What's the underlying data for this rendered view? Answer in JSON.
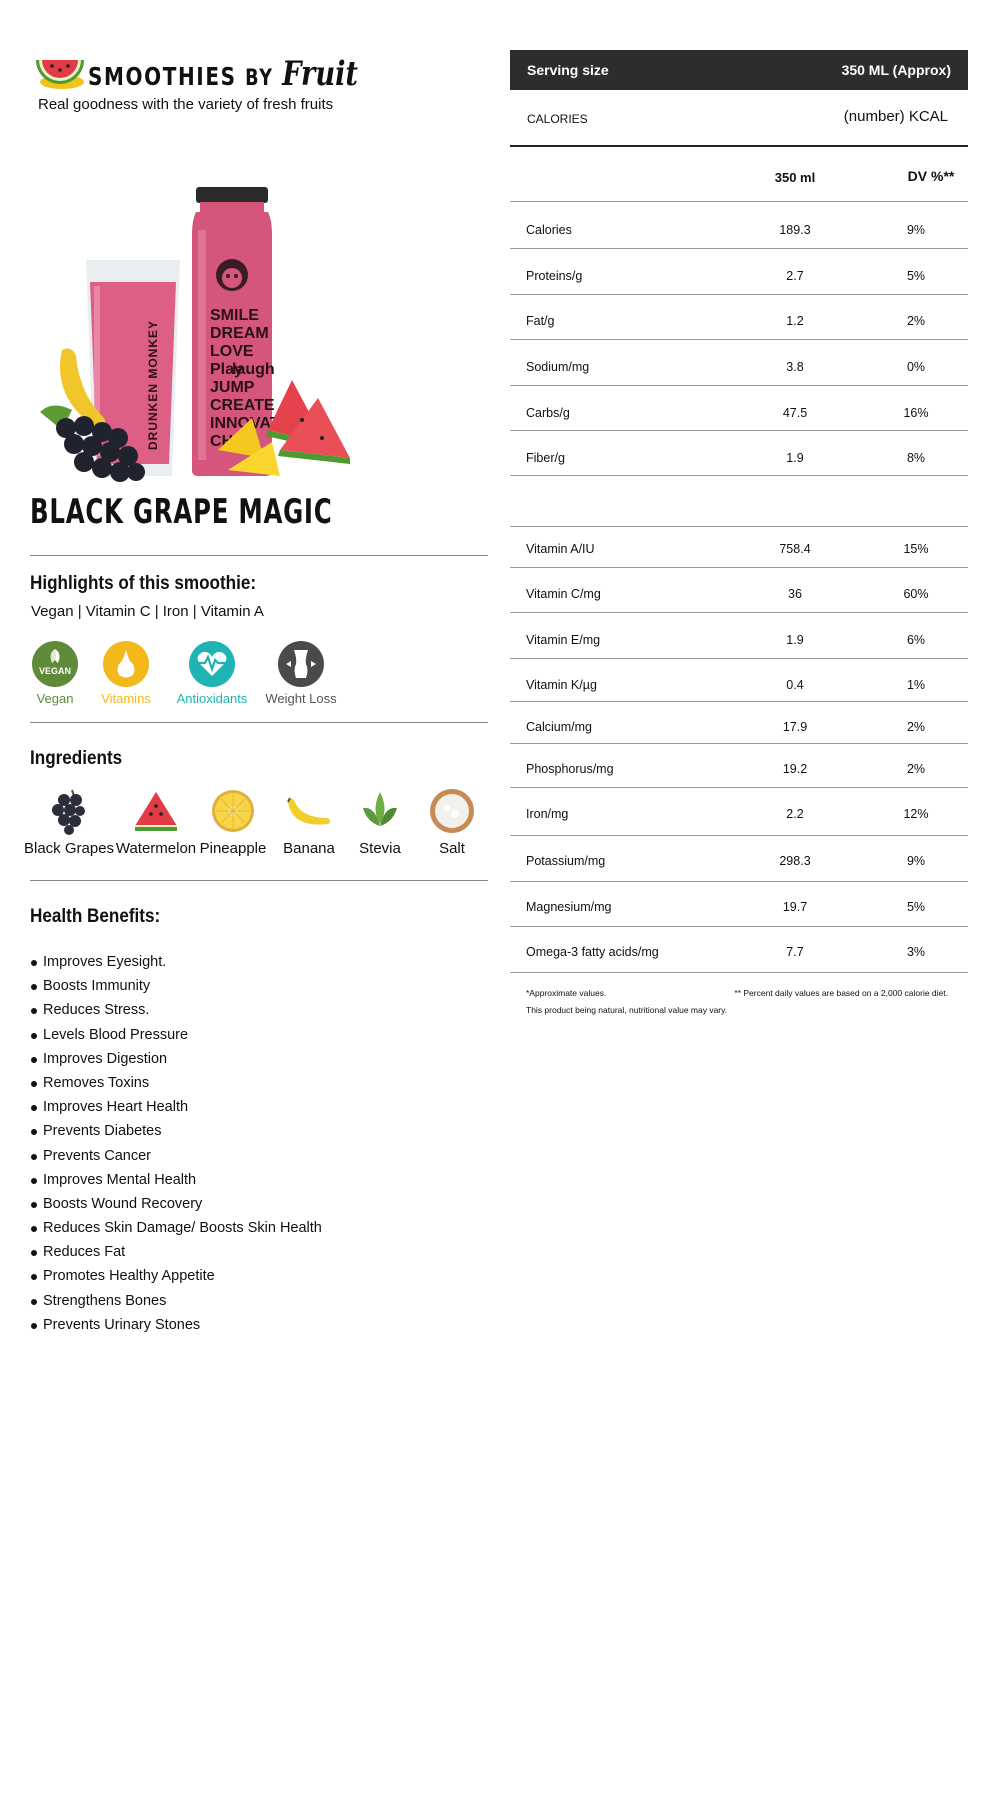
{
  "brand": {
    "name_main": "SMOOTHIES",
    "name_by": "BY",
    "name_fruit": "Fruit",
    "tagline": "Real goodness with the variety of fresh fruits"
  },
  "hero": {
    "glass_text": "DRUNKEN MONKEY",
    "bottle_text": [
      "SMILE",
      "DREAM",
      "LOVE",
      "Play",
      "laugh",
      "JUMP",
      "CREATE",
      "INNOVATE",
      "CHILL"
    ]
  },
  "product": {
    "title": "BLACK GRAPE MAGIC"
  },
  "highlights": {
    "heading": "Highlights of this smoothie:",
    "text": "Vegan | Vitamin C | Iron | Vitamin A",
    "badges": [
      {
        "label": "Vegan",
        "color": "#5f8a3a",
        "icon": "vegan-leaf-icon",
        "icon_text": "VEGAN"
      },
      {
        "label": "Vitamins",
        "color": "#f2b81c",
        "icon": "pear-icon"
      },
      {
        "label": "Antioxidants",
        "color": "#1fb3b3",
        "icon": "heartbeat-icon"
      },
      {
        "label": "Weight Loss",
        "color": "#4a4a4a",
        "icon": "body-shape-icon"
      }
    ]
  },
  "ingredients": {
    "heading": "Ingredients",
    "items": [
      {
        "label": "Black Grapes",
        "icon": "black-grapes-icon"
      },
      {
        "label": "Watermelon",
        "icon": "watermelon-icon"
      },
      {
        "label": "Pineapple",
        "icon": "pineapple-icon"
      },
      {
        "label": "Banana",
        "icon": "banana-icon"
      },
      {
        "label": "Stevia",
        "icon": "stevia-leaf-icon"
      },
      {
        "label": "Salt",
        "icon": "salt-bowl-icon"
      }
    ]
  },
  "benefits": {
    "heading": "Health Benefits:",
    "items": [
      "Improves Eyesight.",
      "Boosts Immunity",
      "Reduces Stress.",
      "Levels Blood Pressure",
      "Improves Digestion",
      "Removes Toxins",
      "Improves Heart Health",
      "Prevents Diabetes",
      "Prevents Cancer",
      "Improves Mental Health",
      "Boosts Wound Recovery",
      "Reduces Skin Damage/ Boosts Skin Health",
      "Reduces Fat",
      "Promotes Healthy Appetite",
      "Strengthens Bones",
      "Prevents Urinary Stones"
    ]
  },
  "nutrition": {
    "serving_label": "Serving size",
    "serving_value": "350 ML (Approx)",
    "calories_label": "CALORIES",
    "calories_value": "(number) KCAL",
    "col_amount": "350 ml",
    "col_dv": "DV %**",
    "macros": [
      {
        "name": "Calories",
        "value": "189.3",
        "dv": "9%"
      },
      {
        "name": "Proteins/g",
        "value": "2.7",
        "dv": "5%"
      },
      {
        "name": "Fat/g",
        "value": "1.2",
        "dv": "2%"
      },
      {
        "name": "Sodium/mg",
        "value": "3.8",
        "dv": "0%"
      },
      {
        "name": "Carbs/g",
        "value": "47.5",
        "dv": "16%"
      },
      {
        "name": "Fiber/g",
        "value": "1.9",
        "dv": "8%"
      }
    ],
    "micros": [
      {
        "name": "Vitamin A/IU",
        "value": "758.4",
        "dv": "15%"
      },
      {
        "name": "Vitamin C/mg",
        "value": "36",
        "dv": "60%"
      },
      {
        "name": "Vitamin E/mg",
        "value": "1.9",
        "dv": "6%"
      },
      {
        "name": "Vitamin K/µg",
        "value": "0.4",
        "dv": "1%"
      },
      {
        "name": "Calcium/mg",
        "value": "17.9",
        "dv": "2%"
      },
      {
        "name": "Phosphorus/mg",
        "value": "19.2",
        "dv": "2%"
      },
      {
        "name": "Iron/mg",
        "value": "2.2",
        "dv": "12%"
      },
      {
        "name": "Potassium/mg",
        "value": "298.3",
        "dv": "9%"
      },
      {
        "name": "Magnesium/mg",
        "value": "19.7",
        "dv": "5%"
      },
      {
        "name": "Omega-3 fatty acids/mg",
        "value": "7.7",
        "dv": "3%"
      }
    ],
    "footnote_1": "*Approximate values.",
    "footnote_2": "This product being natural, nutritional value may vary.",
    "footnote_3": "** Percent daily values are based on a 2,000 calorie diet."
  }
}
